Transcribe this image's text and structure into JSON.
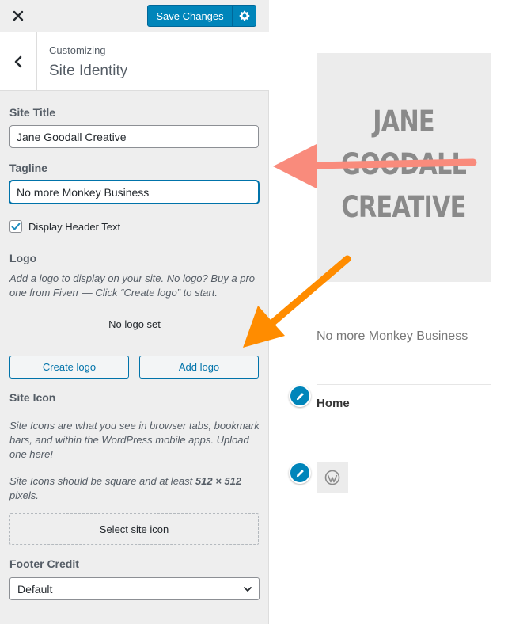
{
  "topbar": {
    "close_icon": "close-icon",
    "save_label": "Save Changes",
    "settings_icon": "gear-icon"
  },
  "section": {
    "breadcrumb": "Customizing",
    "title": "Site Identity",
    "back_icon": "chevron-left-icon"
  },
  "form": {
    "site_title_label": "Site Title",
    "site_title_value": "Jane Goodall Creative",
    "tagline_label": "Tagline",
    "tagline_value": "No more Monkey Business",
    "display_header_label": "Display Header Text",
    "display_header_checked": true,
    "logo_label": "Logo",
    "logo_desc": "Add a logo to display on your site. No logo? Buy a pro one from Fiverr — Click “Create logo” to start.",
    "no_logo": "No logo set",
    "create_logo": "Create logo",
    "add_logo": "Add logo",
    "site_icon_label": "Site Icon",
    "site_icon_desc1": "Site Icons are what you see in browser tabs, bookmark bars, and within the WordPress mobile apps. Upload one here!",
    "site_icon_desc2_a": "Site Icons should be square and at least ",
    "site_icon_desc2_b": "512 × 512",
    "site_icon_desc2_c": " pixels.",
    "select_site_icon": "Select site icon",
    "footer_credit_label": "Footer Credit",
    "footer_credit_value": "Default"
  },
  "preview": {
    "title_line1": "JANE",
    "title_line2": "GOODALL",
    "title_line3": "CREATIVE",
    "tagline": "No more Monkey Business",
    "menu_item": "Home",
    "edit_icon": "pencil-icon",
    "wp_icon": "wordpress-icon"
  },
  "colors": {
    "primary": "#0085ba",
    "arrow_salmon": "#f98b7c",
    "arrow_orange": "#ff8c00"
  }
}
